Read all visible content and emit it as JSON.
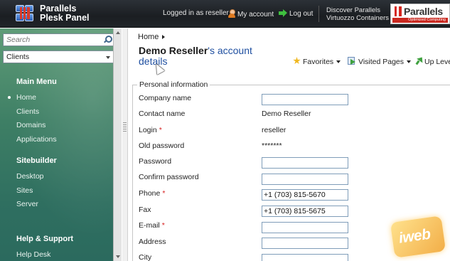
{
  "header": {
    "app_name_line1": "Parallels",
    "app_name_line2": "Plesk Panel",
    "logged_in": "Logged in as reseller",
    "my_account": "My account",
    "log_out": "Log out",
    "discover_line1": "Discover Parallels",
    "discover_line2": "Virtuozzo Containers",
    "brand_logo": "Parallels",
    "brand_tagline": "Optimized Computing"
  },
  "sidebar": {
    "search_placeholder": "Search",
    "context_select": "Clients",
    "sections": [
      {
        "title": "Main Menu",
        "items": [
          "Home",
          "Clients",
          "Domains",
          "Applications"
        ],
        "active": "Home"
      },
      {
        "title": "Sitebuilder",
        "items": [
          "Desktop",
          "Sites",
          "Server"
        ]
      },
      {
        "title": "Help & Support",
        "items": [
          "Help Desk"
        ]
      }
    ]
  },
  "breadcrumb": {
    "home": "Home"
  },
  "page": {
    "title_name": "Demo Reseller",
    "title_suffix": "'s account",
    "title_link": "details"
  },
  "toolbar": {
    "favorites": "Favorites",
    "visited_pages": "Visited Pages",
    "up_level": "Up Leve"
  },
  "form": {
    "legend": "Personal information",
    "fields": [
      {
        "label": "Company name",
        "type": "input",
        "value": ""
      },
      {
        "label": "Contact name",
        "type": "static",
        "value": "Demo Reseller"
      },
      {
        "label": "Login",
        "required": true,
        "type": "static",
        "value": "reseller"
      },
      {
        "label": "Old password",
        "type": "static",
        "value": "*******"
      },
      {
        "label": "Password",
        "type": "input",
        "value": ""
      },
      {
        "label": "Confirm password",
        "type": "input",
        "value": ""
      },
      {
        "label": "Phone",
        "required": true,
        "type": "input",
        "value": "+1 (703) 815-5670"
      },
      {
        "label": "Fax",
        "type": "input",
        "value": "+1 (703) 815-5675"
      },
      {
        "label": "E-mail",
        "required": true,
        "type": "input",
        "value": ""
      },
      {
        "label": "Address",
        "type": "input",
        "value": ""
      },
      {
        "label": "City",
        "type": "input",
        "value": ""
      }
    ]
  },
  "watermark": "iweb",
  "colors": {
    "header_bg": "#1f2327",
    "sidebar_bg": "#3e7f65",
    "title_link": "#1f4fa0",
    "required_star": "#d62020"
  }
}
